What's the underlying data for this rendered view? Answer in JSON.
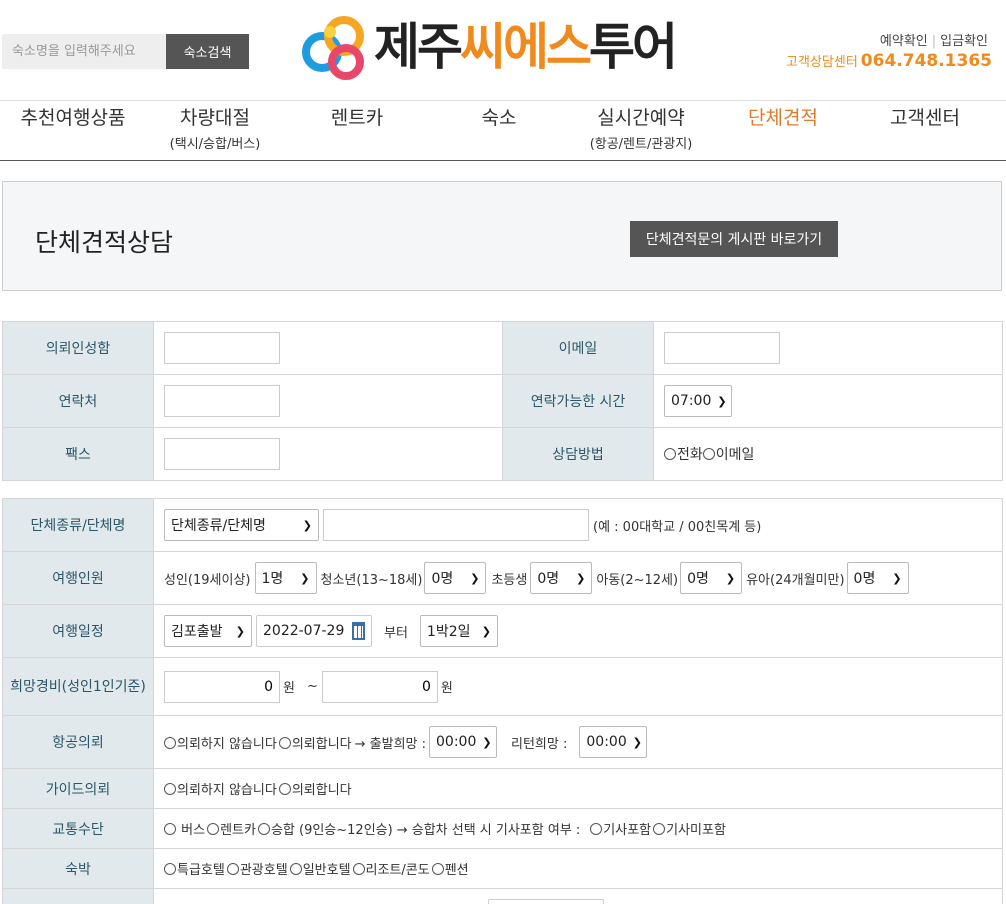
{
  "header": {
    "search_placeholder": "숙소명을 입력해주세요",
    "search_button": "숙소검색",
    "logo_text_black1": "제주",
    "logo_text_orange": "씨에스",
    "logo_text_black2": "투어",
    "link_reservation_check": "예약확인",
    "link_separator": "|",
    "link_deposit_check": "입금확인",
    "phone_label": "고객상담센터",
    "phone_number": "064.748.1365"
  },
  "nav": [
    {
      "label": "추천여행상품",
      "sub": ""
    },
    {
      "label": "차량대절",
      "sub": "(택시/승합/버스)"
    },
    {
      "label": "렌트카",
      "sub": ""
    },
    {
      "label": "숙소",
      "sub": ""
    },
    {
      "label": "실시간예약",
      "sub": "(항공/렌트/관광지)"
    },
    {
      "label": "단체견적",
      "sub": ""
    },
    {
      "label": "고객센터",
      "sub": ""
    }
  ],
  "title_box": {
    "title": "단체견적상담",
    "board_button": "단체견적문의 게시판 바로가기"
  },
  "contact_form": {
    "name_label": "의뢰인성함",
    "email_label": "이메일",
    "phone_label": "연락처",
    "time_label": "연락가능한 시간",
    "time_value": "07:00",
    "fax_label": "팩스",
    "method_label": "상담방법",
    "method_options": [
      "전화",
      "이메일"
    ]
  },
  "group_form": {
    "group_label": "단체종류/단체명",
    "group_select": "단체종류/단체명",
    "group_example": "(예 : 00대학교 / 00친목계 등)",
    "people_label": "여행인원",
    "adult": "성인(19세이상)",
    "adult_value": "1명",
    "teen": "청소년(13~18세)",
    "teen_value": "0명",
    "elementary": "초등생",
    "elementary_value": "0명",
    "child": "아동(2~12세)",
    "child_value": "0명",
    "infant": "유아(24개월미만)",
    "infant_value": "0명",
    "schedule_label": "여행일정",
    "departure_value": "김포출발",
    "date_value": "2022-07-29",
    "from_text": "부터",
    "nights_value": "1박2일",
    "budget_label": "희망경비(성인1인기준)",
    "budget_from": "0",
    "budget_to": "0",
    "won": "원",
    "tilde": "~",
    "flight_label": "항공의뢰",
    "flight_opt1": "의뢰하지 않습니다",
    "flight_opt2": "의뢰합니다",
    "flight_depart": "→ 출발희망 :",
    "flight_depart_value": "00:00",
    "flight_return": "리턴희망 :",
    "flight_return_value": "00:00",
    "guide_label": "가이드의뢰",
    "guide_opt1": "의뢰하지 않습니다",
    "guide_opt2": "의뢰합니다",
    "transport_label": "교통수단",
    "transport_opts": [
      " 버스",
      "렌트카",
      "승합 (9인승~12인승)"
    ],
    "transport_note": "→ 승합차 선택 시 기사포함 여부 :",
    "driver_opts": [
      "기사포함",
      "기사미포함"
    ],
    "lodging_label": "숙박",
    "lodging_opts": [
      "특급호텔",
      "관광호텔",
      "일반호텔",
      "리조트/콘도",
      "펜션"
    ]
  }
}
